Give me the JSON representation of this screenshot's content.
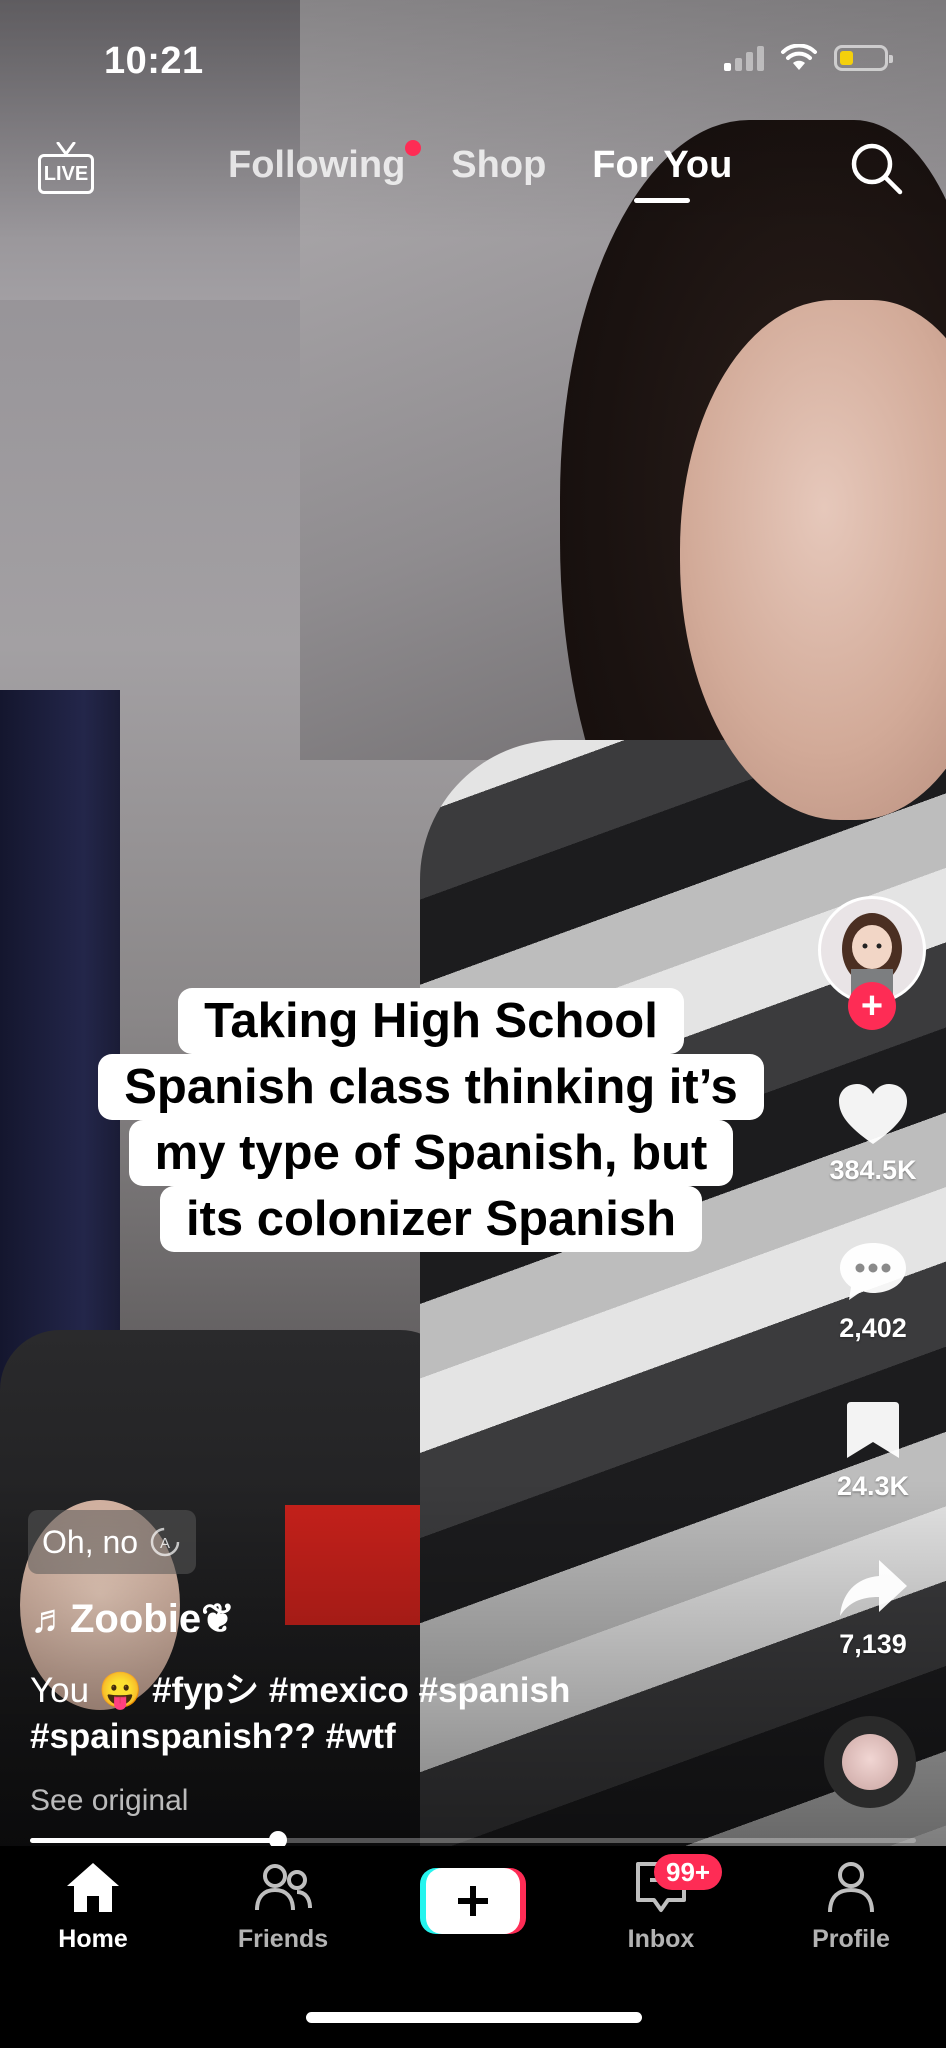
{
  "status_bar": {
    "time": "10:21",
    "battery_level": 0.3,
    "signal_bars": 1
  },
  "top_nav": {
    "live_label": "LIVE",
    "tabs": [
      {
        "label": "Following",
        "has_dot": true
      },
      {
        "label": "Shop"
      },
      {
        "label": "For You",
        "active": true
      }
    ]
  },
  "video": {
    "overlay_text": [
      "Taking High School",
      "Spanish class thinking it’s",
      "my type of Spanish, but",
      "its colonizer Spanish"
    ],
    "progress": 0.28
  },
  "actions": {
    "likes": "384.5K",
    "comments": "2,402",
    "saves": "24.3K",
    "shares": "7,139"
  },
  "info": {
    "search_chip": "Oh, no",
    "username": "♬Zoobie❦",
    "description_prefix": "You 😛 ",
    "hashtags": [
      "#fypシ",
      "#mexico",
      "#spanish",
      "#spainspanish??",
      "#wtf"
    ],
    "see_original": "See original"
  },
  "tab_bar": {
    "home": "Home",
    "friends": "Friends",
    "inbox": "Inbox",
    "inbox_badge": "99+",
    "profile": "Profile"
  },
  "colors": {
    "accent": "#fe2c55",
    "cyan": "#25f4ee",
    "battery": "#f4d00c"
  }
}
